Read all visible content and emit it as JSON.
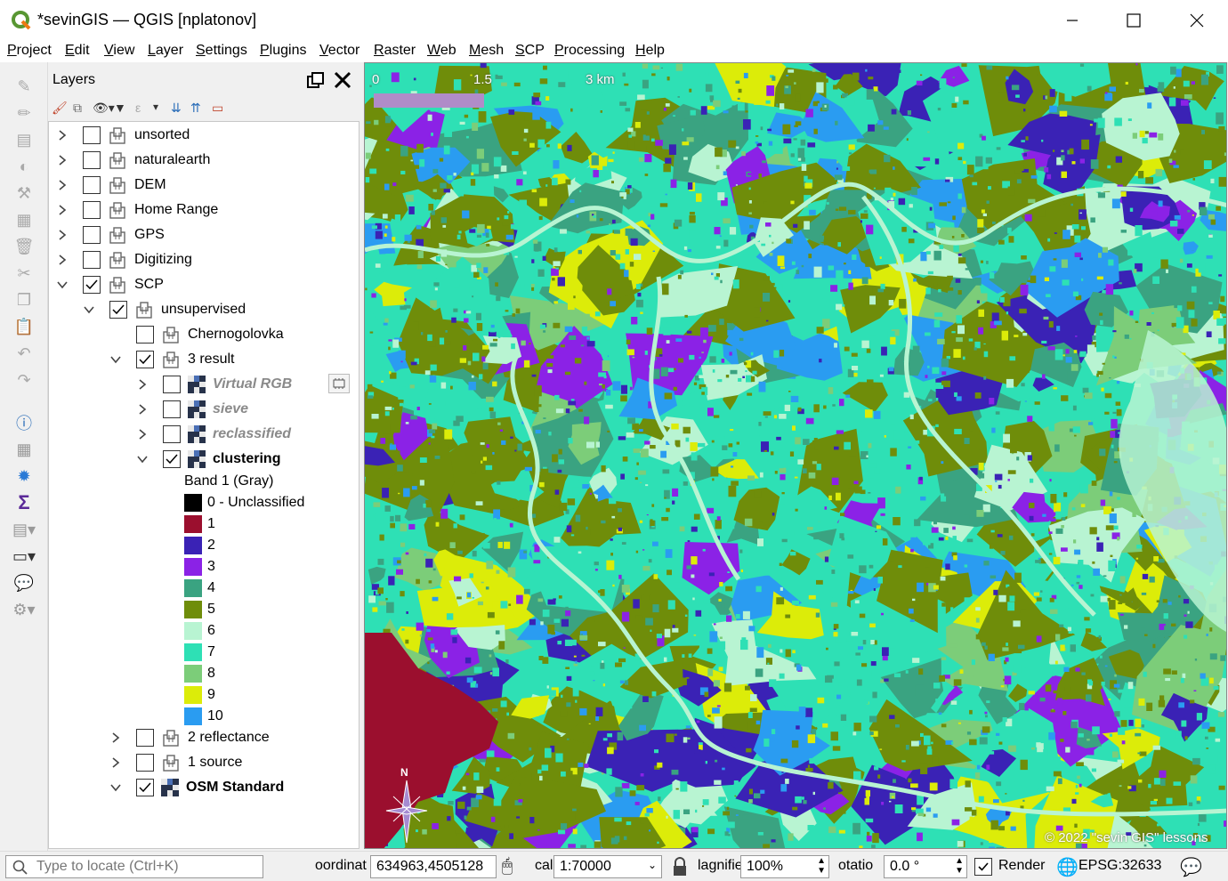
{
  "window": {
    "title": "*sevinGIS — QGIS [nplatonov]"
  },
  "menu": [
    "Project",
    "Edit",
    "View",
    "Layer",
    "Settings",
    "Plugins",
    "Vector",
    "Raster",
    "Web",
    "Mesh",
    "SCP",
    "Processing",
    "Help"
  ],
  "layers_panel": {
    "title": "Layers",
    "tree": [
      {
        "label": "unsorted",
        "checked": false,
        "expanded": false,
        "level": 0,
        "kind": "group"
      },
      {
        "label": "naturalearth",
        "checked": false,
        "expanded": false,
        "level": 0,
        "kind": "group"
      },
      {
        "label": "DEM",
        "checked": false,
        "expanded": false,
        "level": 0,
        "kind": "group"
      },
      {
        "label": "Home Range",
        "checked": false,
        "expanded": false,
        "level": 0,
        "kind": "group"
      },
      {
        "label": "GPS",
        "checked": false,
        "expanded": false,
        "level": 0,
        "kind": "group"
      },
      {
        "label": "Digitizing",
        "checked": false,
        "expanded": false,
        "level": 0,
        "kind": "group"
      },
      {
        "label": "SCP",
        "checked": true,
        "expanded": true,
        "level": 0,
        "kind": "group"
      },
      {
        "label": "unsupervised",
        "checked": true,
        "expanded": true,
        "level": 1,
        "kind": "group"
      },
      {
        "label": "Chernogolovka",
        "checked": false,
        "expanded": null,
        "level": 2,
        "kind": "group"
      },
      {
        "label": "3 result",
        "checked": true,
        "expanded": true,
        "level": 2,
        "kind": "group"
      },
      {
        "label": "Virtual RGB",
        "checked": false,
        "expanded": false,
        "level": 3,
        "kind": "raster",
        "style": "italic"
      },
      {
        "label": "sieve",
        "checked": false,
        "expanded": false,
        "level": 3,
        "kind": "raster",
        "style": "italic"
      },
      {
        "label": "reclassified",
        "checked": false,
        "expanded": false,
        "level": 3,
        "kind": "raster",
        "style": "italic"
      },
      {
        "label": "clustering",
        "checked": true,
        "expanded": true,
        "level": 3,
        "kind": "raster",
        "style": "bold"
      },
      {
        "label": "2 reflectance",
        "checked": false,
        "expanded": false,
        "level": 2,
        "kind": "group"
      },
      {
        "label": "1 source",
        "checked": false,
        "expanded": false,
        "level": 2,
        "kind": "group"
      },
      {
        "label": "OSM Standard",
        "checked": true,
        "expanded": true,
        "level": 2,
        "kind": "raster",
        "style": "bold"
      }
    ],
    "legend": {
      "band": "Band 1 (Gray)",
      "classes": [
        {
          "label": "0 - Unclassified",
          "color": "#000000"
        },
        {
          "label": "1",
          "color": "#9b0f2e"
        },
        {
          "label": "2",
          "color": "#3a22b5"
        },
        {
          "label": "3",
          "color": "#8b22e6"
        },
        {
          "label": "4",
          "color": "#3aa381"
        },
        {
          "label": "5",
          "color": "#6f8d0a"
        },
        {
          "label": "6",
          "color": "#b8f4d2"
        },
        {
          "label": "7",
          "color": "#2ee0b5"
        },
        {
          "label": "8",
          "color": "#7ccd79"
        },
        {
          "label": "9",
          "color": "#dcec09"
        },
        {
          "label": "10",
          "color": "#2a9cf1"
        }
      ]
    }
  },
  "map": {
    "scalebar": {
      "t0": "0",
      "t1": "1.5",
      "t2": "3 km"
    },
    "north": "N",
    "copyright": "© 2022 \"sevin GIS\" lessons"
  },
  "statusbar": {
    "locate_placeholder": "Type to locate (Ctrl+K)",
    "coordinate_label": "oordinat",
    "coordinate_value": "634963,4505128",
    "scale_label": "cal",
    "scale_value": "1:70000",
    "magnifier_label": "lagnifie",
    "magnifier_value": "100%",
    "rotation_label": "otatio",
    "rotation_value": "0.0 °",
    "render_label": "Render",
    "render_checked": true,
    "crs": "EPSG:32633"
  }
}
